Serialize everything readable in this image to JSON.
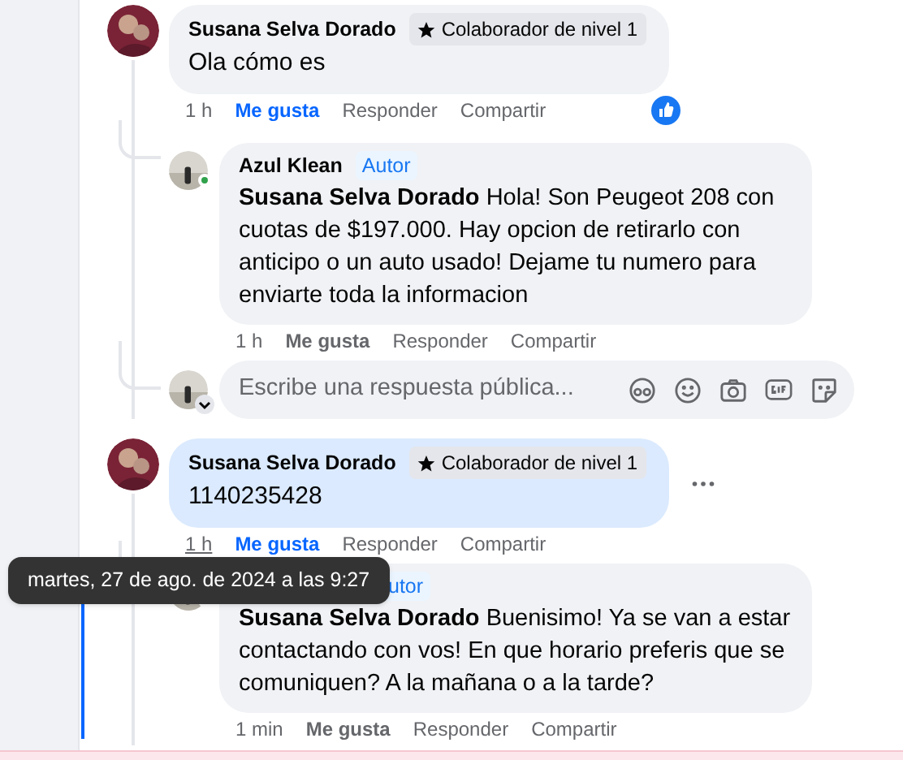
{
  "comments": [
    {
      "author": "Susana Selva Dorado",
      "badge": {
        "kind": "contributor",
        "label": "Colaborador de nivel 1"
      },
      "text": "Ola cómo es",
      "highlighted": false,
      "more_menu": false,
      "time": "1 h",
      "time_hovered": false,
      "like_label": "Me gusta",
      "liked": true,
      "reply_label": "Responder",
      "share_label": "Compartir",
      "reaction": true,
      "replies": [
        {
          "author": "Azul Klean",
          "badge": {
            "kind": "author",
            "label": "Autor"
          },
          "mention": "Susana Selva Dorado",
          "text": "Hola! Son Peugeot 208 con cuotas de $197.000. Hay opcion de retirarlo con anticipo o un auto usado! Dejame tu numero para enviarte toda la informacion",
          "time": "1 h",
          "like_label": "Me gusta",
          "liked": false,
          "reply_label": "Responder",
          "share_label": "Compartir"
        }
      ],
      "reply_box": {
        "placeholder": "Escribe una respuesta pública..."
      }
    },
    {
      "author": "Susana Selva Dorado",
      "badge": {
        "kind": "contributor",
        "label": "Colaborador de nivel 1"
      },
      "text": "1140235428",
      "highlighted": true,
      "more_menu": true,
      "time": "1 h",
      "time_hovered": true,
      "like_label": "Me gusta",
      "liked": true,
      "reply_label": "Responder",
      "share_label": "Compartir",
      "reaction": false,
      "replies": [
        {
          "badge": {
            "kind": "author",
            "label": "utor"
          },
          "mention": "Susana Selva Dorado",
          "text": "Buenisimo! Ya se van a estar contactando con vos! En que horario preferis que se comuniquen? A la mañana o a la tarde?",
          "time": "1 min",
          "like_label": "Me gusta",
          "liked": false,
          "reply_label": "Responder",
          "share_label": "Compartir"
        }
      ]
    }
  ],
  "tooltip": {
    "text": "martes, 27 de ago. de 2024 a las 9:27"
  }
}
